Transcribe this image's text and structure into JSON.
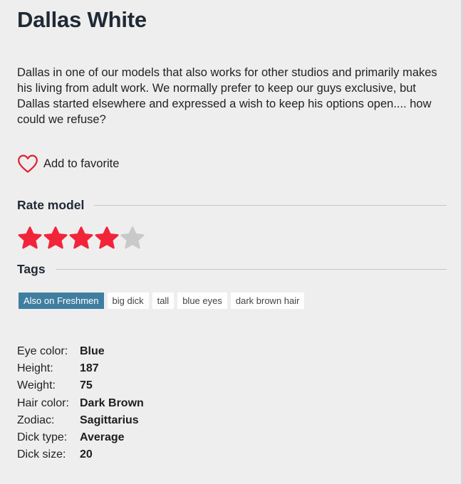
{
  "model": {
    "name": "Dallas White",
    "bio": "Dallas in one of our models that also works for other studios and primarily makes his living from adult work.  We normally prefer to keep our guys exclusive, but Dallas started elsewhere and expressed a wish to keep his options open.... how could we refuse?"
  },
  "favorite": {
    "label": "Add to favorite",
    "icon": "heart-outline-icon",
    "color": "#e0202e"
  },
  "rating": {
    "title": "Rate model",
    "value": 4,
    "max": 5,
    "filled_color": "#f2243a",
    "empty_color": "#c9c9c9"
  },
  "tags": {
    "title": "Tags",
    "items": [
      {
        "label": "Also on Freshmen",
        "active": true
      },
      {
        "label": "big dick",
        "active": false
      },
      {
        "label": "tall",
        "active": false
      },
      {
        "label": "blue eyes",
        "active": false
      },
      {
        "label": "dark brown hair",
        "active": false
      }
    ],
    "active_color": "#3f7ea0"
  },
  "details": [
    {
      "label": "Eye color:",
      "value": "Blue"
    },
    {
      "label": "Height:",
      "value": "187"
    },
    {
      "label": "Weight:",
      "value": "75"
    },
    {
      "label": "Hair color:",
      "value": "Dark Brown"
    },
    {
      "label": "Zodiac:",
      "value": "Sagittarius"
    },
    {
      "label": "Dick type:",
      "value": "Average"
    },
    {
      "label": "Dick size:",
      "value": "20"
    }
  ]
}
